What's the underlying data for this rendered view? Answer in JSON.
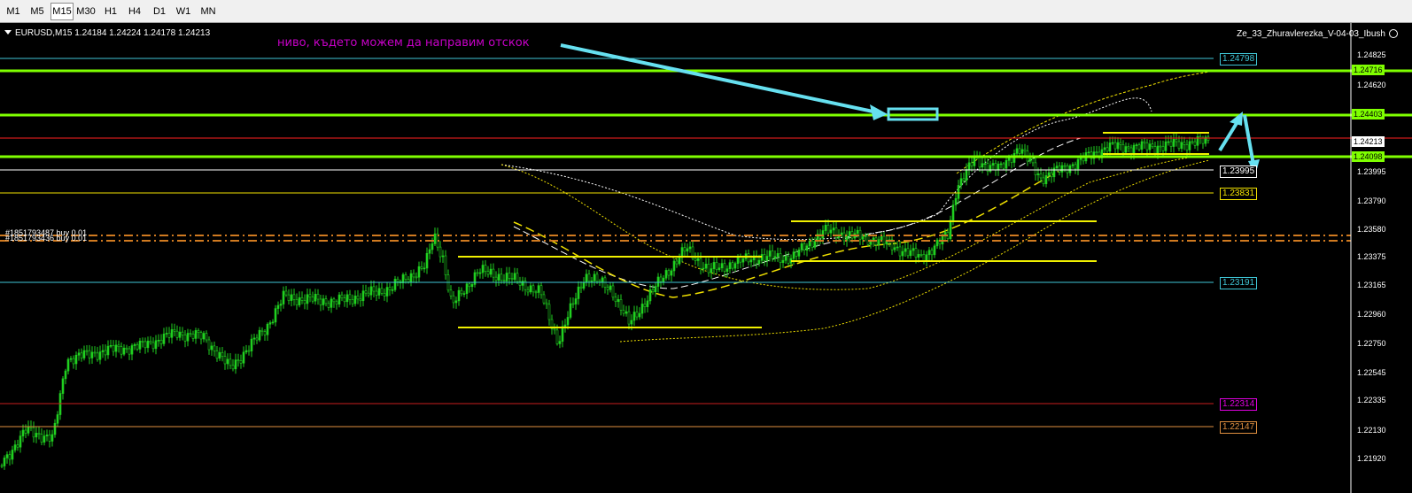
{
  "toolbar": {
    "timeframes": [
      "M1",
      "M5",
      "M15",
      "M30",
      "H1",
      "H4",
      "D1",
      "W1",
      "MN"
    ],
    "active": "M15"
  },
  "chart": {
    "symbol_info": "EURUSD,M15  1.24184 1.24224 1.24178 1.24213",
    "indicator_name": "Ze_33_Zhuravlerezka_V-04-03_Ibush",
    "annotation": "ниво, където можем да направим отскок",
    "orders": [
      "#1851793487 buy 0.01",
      "#1851793436 buy 0.01"
    ],
    "line_labels": [
      {
        "text": "1.24798",
        "color": "#3fc6d6"
      },
      {
        "text": "1.23995",
        "color": "#ffffff"
      },
      {
        "text": "1.23831",
        "color": "#f0e000"
      },
      {
        "text": "1.23191",
        "color": "#3fc6d6"
      },
      {
        "text": "1.22314",
        "color": "#e000e0"
      },
      {
        "text": "1.22147",
        "color": "#e09040"
      }
    ],
    "price_axis": {
      "ticks": [
        "1.24825",
        "1.24620",
        "1.23995",
        "1.23790",
        "1.23580",
        "1.23375",
        "1.23165",
        "1.22960",
        "1.22750",
        "1.22545",
        "1.22335",
        "1.22130",
        "1.21920"
      ],
      "flagged_prices": [
        {
          "text": "1.24716",
          "bg": "#7fff00",
          "fg": "#000000"
        },
        {
          "text": "1.24403",
          "bg": "#7fff00",
          "fg": "#000000"
        },
        {
          "text": "1.24213",
          "bg": "#ffffff",
          "fg": "#000000"
        },
        {
          "text": "1.24098",
          "bg": "#7fff00",
          "fg": "#000000"
        }
      ]
    }
  }
}
